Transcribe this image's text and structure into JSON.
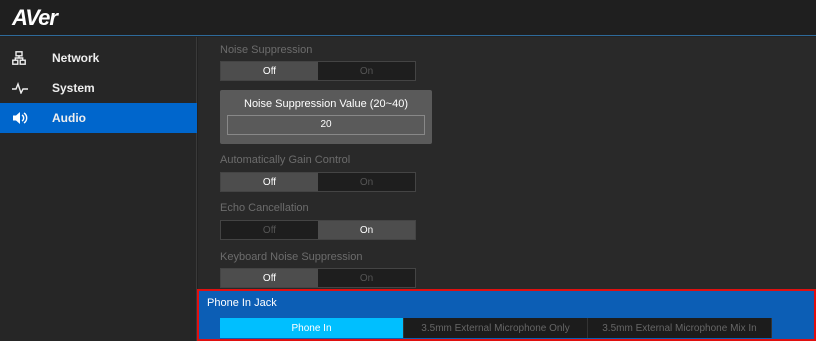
{
  "brand": {
    "logo": "AVer"
  },
  "sidebar": {
    "items": [
      {
        "label": "Network",
        "icon": "network-icon",
        "active": false
      },
      {
        "label": "System",
        "icon": "pulse-icon",
        "active": false
      },
      {
        "label": "Audio",
        "icon": "speaker-icon",
        "active": true
      }
    ]
  },
  "audio": {
    "noise_suppression": {
      "label": "Noise Suppression",
      "options": [
        "Off",
        "On"
      ],
      "selected": "Off"
    },
    "noise_suppression_value": {
      "label": "Noise Suppression Value (20~40)",
      "value": "20"
    },
    "agc": {
      "label": "Automatically Gain Control",
      "options": [
        "Off",
        "On"
      ],
      "selected": "Off"
    },
    "echo_cancellation": {
      "label": "Echo Cancellation",
      "options": [
        "Off",
        "On"
      ],
      "selected": "On"
    },
    "keyboard_noise": {
      "label": "Keyboard Noise Suppression",
      "options": [
        "Off",
        "On"
      ],
      "selected": "Off"
    },
    "phone_in_jack": {
      "label": "Phone In Jack",
      "options": [
        "Phone In",
        "3.5mm External Microphone Only",
        "3.5mm External Microphone Mix In"
      ],
      "selected": "Phone In"
    }
  },
  "colors": {
    "accent": "#0066cc",
    "highlight": "#00bfff",
    "alert_border": "#e01010"
  }
}
